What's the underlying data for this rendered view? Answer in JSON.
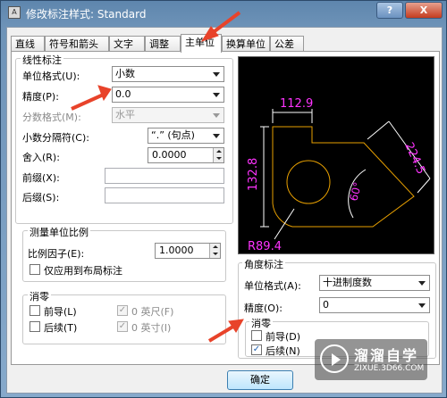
{
  "window": {
    "title": "修改标注样式: Standard",
    "help_label": "?",
    "close_label": "X"
  },
  "tabs": [
    {
      "label": "直线"
    },
    {
      "label": "符号和箭头"
    },
    {
      "label": "文字"
    },
    {
      "label": "调整"
    },
    {
      "label": "主单位"
    },
    {
      "label": "换算单位"
    },
    {
      "label": "公差"
    }
  ],
  "linear": {
    "group_title": "线性标注",
    "unit_format_label": "单位格式(U):",
    "unit_format_value": "小数",
    "precision_label": "精度(P):",
    "precision_value": "0.0",
    "fraction_format_label": "分数格式(M):",
    "fraction_format_value": "水平",
    "decimal_separator_label": "小数分隔符(C):",
    "decimal_separator_value": "“.” (句点)",
    "round_off_label": "舍入(R):",
    "round_off_value": "0.0000",
    "prefix_label": "前缀(X):",
    "prefix_value": "",
    "suffix_label": "后缀(S):",
    "suffix_value": ""
  },
  "scale": {
    "group_title": "测量单位比例",
    "factor_label": "比例因子(E):",
    "factor_value": "1.0000",
    "layout_only_label": "仅应用到布局标注",
    "layout_only_checked": false
  },
  "zero_suppression": {
    "group_title": "消零",
    "leading_label": "前导(L)",
    "leading_checked": false,
    "trailing_label": "后续(T)",
    "trailing_checked": false,
    "zero_feet_label": "0 英尺(F)",
    "zero_feet_checked": true,
    "zero_inches_label": "0 英寸(I)",
    "zero_inches_checked": true
  },
  "preview": {
    "dim_top": "112.9",
    "dim_left": "132.8",
    "dim_right": "224.5",
    "dim_angle": "60°",
    "dim_radius": "R89.4",
    "colors": {
      "background": "#000000",
      "geometry": "#e8a000",
      "dimension": "#ffffff",
      "text": "#ff33ff"
    }
  },
  "angular": {
    "group_title": "角度标注",
    "unit_format_label": "单位格式(A):",
    "unit_format_value": "十进制度数",
    "precision_label": "精度(O):",
    "precision_value": "0",
    "zero_group_title": "消零",
    "leading_label": "前导(D)",
    "leading_checked": false,
    "trailing_label": "后续(N)",
    "trailing_checked": true
  },
  "buttons": {
    "ok_label": "确定"
  },
  "watermark": {
    "title": "溜溜自学",
    "url": "ZIXUE.3D66.COM"
  },
  "accent_colors": {
    "annotation_arrow": "#e8432a",
    "titlebar": "#6e93b8"
  }
}
